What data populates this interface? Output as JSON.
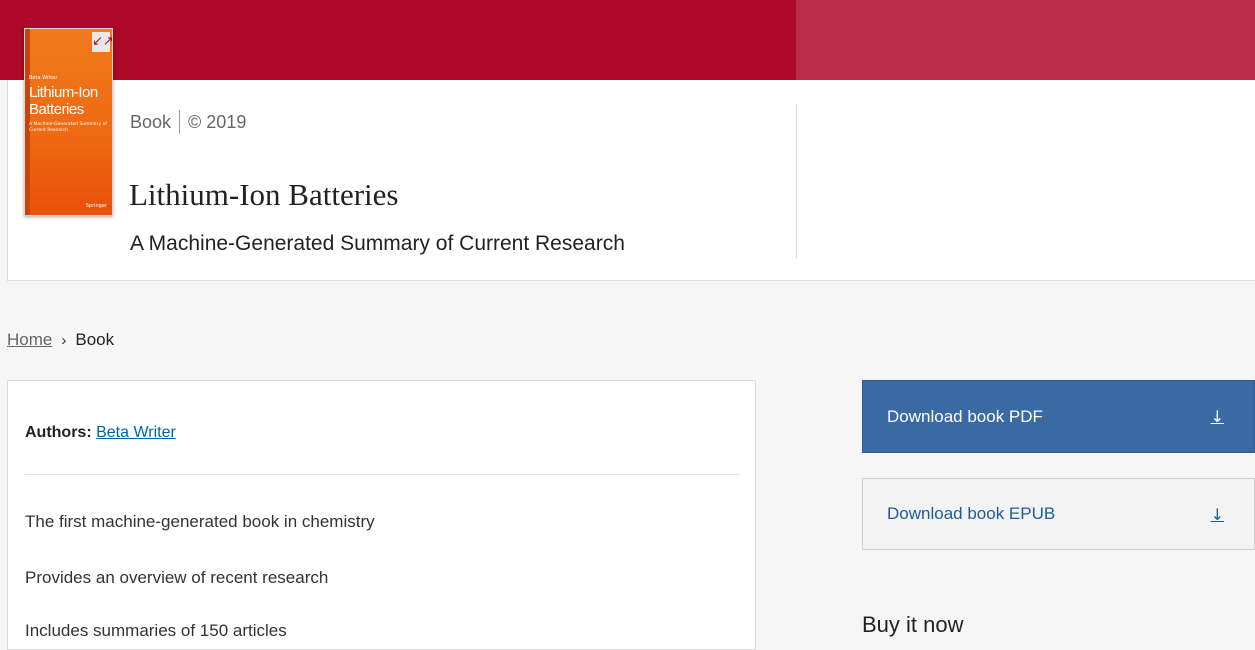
{
  "cover": {
    "expand_icon": "↙↗",
    "author": "Beta Writer",
    "title": "Lithium-Ion Batteries",
    "subtitle": "A Machine-Generated Summary of Current Research",
    "publisher": "Springer"
  },
  "header": {
    "content_type": "Book",
    "copyright": "© 2019",
    "title": "Lithium-Ion Batteries",
    "subtitle": "A Machine-Generated Summary of Current Research"
  },
  "breadcrumb": {
    "home": "Home",
    "separator": "›",
    "current": "Book"
  },
  "main": {
    "authors_label": "Authors:",
    "author_name": "Beta Writer",
    "features": [
      "The first machine-generated book in chemistry",
      "Provides an overview of recent research",
      "Includes summaries of 150 articles"
    ]
  },
  "actions": {
    "download_pdf": "Download book PDF",
    "download_epub": "Download book EPUB",
    "download_icon": "↓",
    "buy_heading": "Buy it now"
  },
  "colors": {
    "brand_red": "#ac0928",
    "brand_red_light": "#bc2b48",
    "primary_button": "#3a6aa4",
    "link": "#006699",
    "cover_orange": "#ee6a12"
  }
}
